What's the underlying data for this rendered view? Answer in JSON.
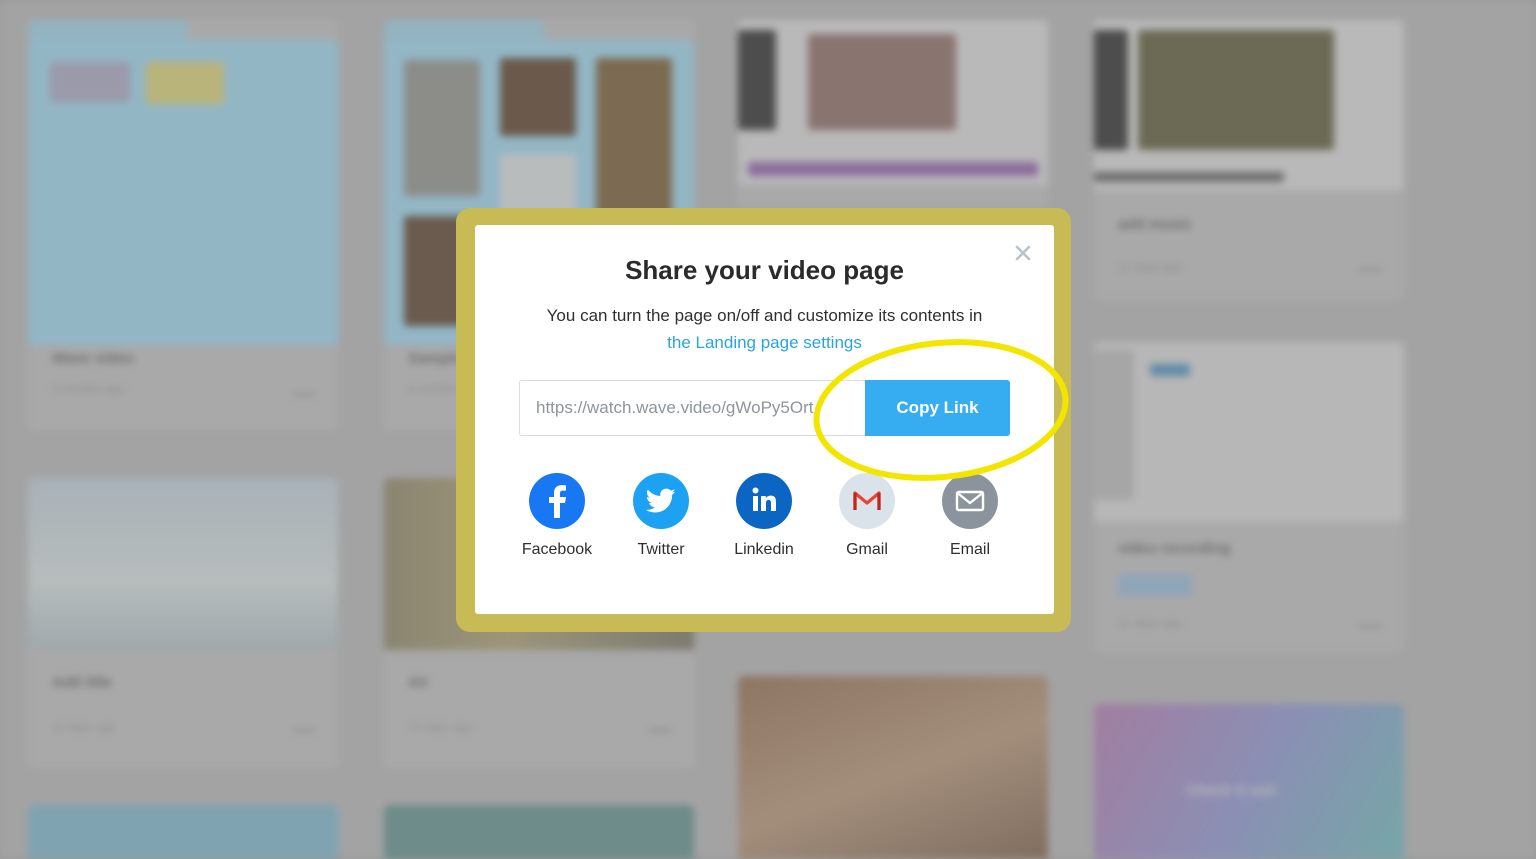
{
  "background": {
    "cards": [
      {
        "title": "Wave video",
        "meta": "6 months ago"
      },
      {
        "title": "Sample",
        "meta": "6 months ago"
      },
      {
        "title": "Add title",
        "meta": "11 days ago"
      },
      {
        "title": "Air",
        "meta": "11 days ago"
      },
      {
        "title": "add music",
        "meta": "11 days ago"
      },
      {
        "title": "video recording",
        "meta": "11 days ago",
        "badge": "Draft"
      },
      {
        "title": "Check it out!"
      }
    ]
  },
  "modal": {
    "title": "Share your video page",
    "description": "You can turn the page on/off and customize its contents in",
    "settings_link": "the Landing page settings",
    "link_value": "https://watch.wave.video/gWoPy5Ort",
    "copy_button": "Copy Link",
    "close_glyph": "×",
    "share_options": [
      {
        "label": "Facebook",
        "icon": "facebook-icon",
        "color": "#1877f2"
      },
      {
        "label": "Twitter",
        "icon": "twitter-icon",
        "color": "#1da1f2"
      },
      {
        "label": "Linkedin",
        "icon": "linkedin-icon",
        "color": "#0a66c2"
      },
      {
        "label": "Gmail",
        "icon": "gmail-icon",
        "color": "#dbe3ea"
      },
      {
        "label": "Email",
        "icon": "email-icon",
        "color": "#8b949c"
      }
    ]
  },
  "colors": {
    "accent": "#36adf0",
    "link": "#2aa3e0",
    "highlight": "#f2e500",
    "modal_halo": "#c8bb55"
  }
}
